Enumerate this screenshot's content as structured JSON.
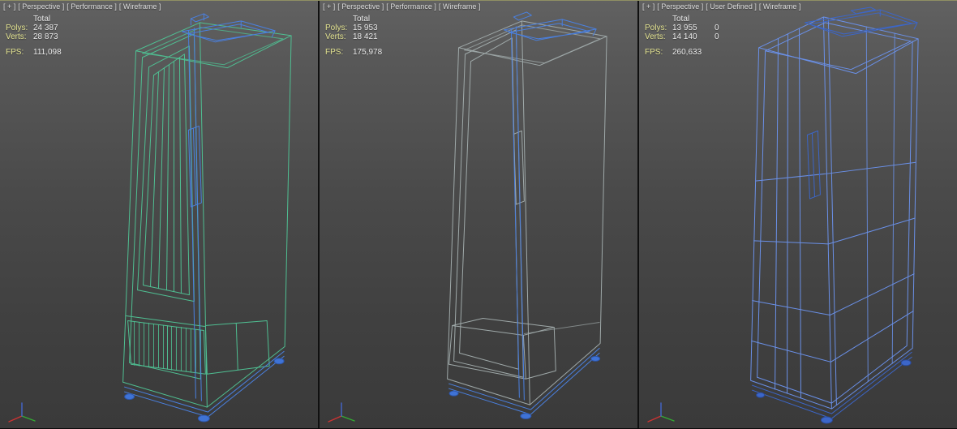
{
  "colors": {
    "wireframe_green": "#4fbf92",
    "wireframe_gray": "#9fa9a9",
    "wireframe_blue": "#6a90e8",
    "accent_blue": "#4a80e0",
    "accent_blue_dark": "#3c66c8",
    "stats_label": "#e4e492",
    "stats_value": "#eaeaea",
    "axis_x": "#cc3333",
    "axis_y": "#33aa33",
    "axis_z": "#4466cc"
  },
  "viewports": [
    {
      "label_parts": [
        "[ + ]",
        "[ Perspective ]",
        "[ Performance ]",
        "[ Wireframe ]"
      ],
      "stats": {
        "total_header": "Total",
        "rows": [
          {
            "label": "Polys:",
            "value": "24 387",
            "extra": ""
          },
          {
            "label": "Verts:",
            "value": "28 873",
            "extra": ""
          }
        ],
        "fps_label": "FPS:",
        "fps_value": "111,098"
      }
    },
    {
      "label_parts": [
        "[ + ]",
        "[ Perspective ]",
        "[ Performance ]",
        "[ Wireframe ]"
      ],
      "stats": {
        "total_header": "Total",
        "rows": [
          {
            "label": "Polys:",
            "value": "15 953",
            "extra": ""
          },
          {
            "label": "Verts:",
            "value": "18 421",
            "extra": ""
          }
        ],
        "fps_label": "FPS:",
        "fps_value": "175,978"
      }
    },
    {
      "label_parts": [
        "[ + ]",
        "[ Perspective ]",
        "[ User Defined ]",
        "[ Wireframe ]"
      ],
      "stats": {
        "total_header": "Total",
        "rows": [
          {
            "label": "Polys:",
            "value": "13 955",
            "extra": "0"
          },
          {
            "label": "Verts:",
            "value": "14 140",
            "extra": "0"
          }
        ],
        "fps_label": "FPS:",
        "fps_value": "260,633"
      }
    }
  ]
}
